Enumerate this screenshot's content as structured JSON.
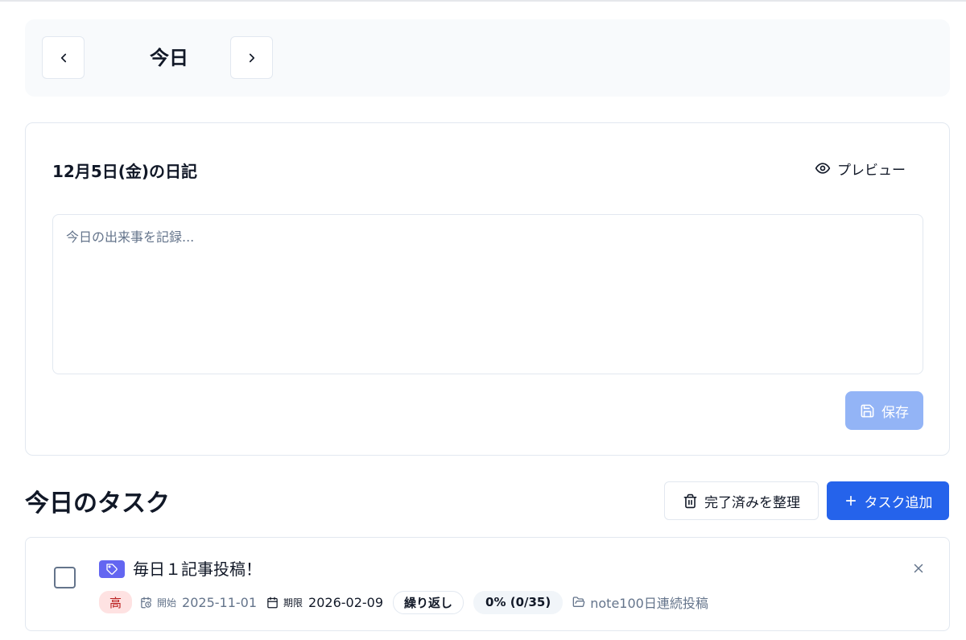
{
  "day_nav": {
    "title": "今日",
    "prev_icon": "chevron-left-icon",
    "next_icon": "chevron-right-icon"
  },
  "diary": {
    "title": "12月5日(金)の日記",
    "preview_label": "プレビュー",
    "preview_icon": "eye-icon",
    "placeholder": "今日の出来事を記録...",
    "value": "",
    "save_label": "保存",
    "save_icon": "save-icon"
  },
  "tasks": {
    "section_title": "今日のタスク",
    "cleanup_label": "完了済みを整理",
    "cleanup_icon": "trash-icon",
    "add_label": "タスク追加",
    "add_icon": "plus-icon",
    "items": [
      {
        "title": "毎日１記事投稿！",
        "tag_icon": "tag-icon",
        "tag_color": "#6366f1",
        "priority": "高",
        "start_label": "開始",
        "start_date": "2025-11-01",
        "due_label": "期限",
        "due_date": "2026-02-09",
        "repeat_label": "繰り返し",
        "progress": "0% (0/35)",
        "project": "note100日連続投稿",
        "done": false
      }
    ]
  },
  "colors": {
    "primary": "#2563eb",
    "save_disabled": "#93b4f6",
    "priority_high_bg": "#fee2e2",
    "priority_high_text": "#b91c1c"
  }
}
